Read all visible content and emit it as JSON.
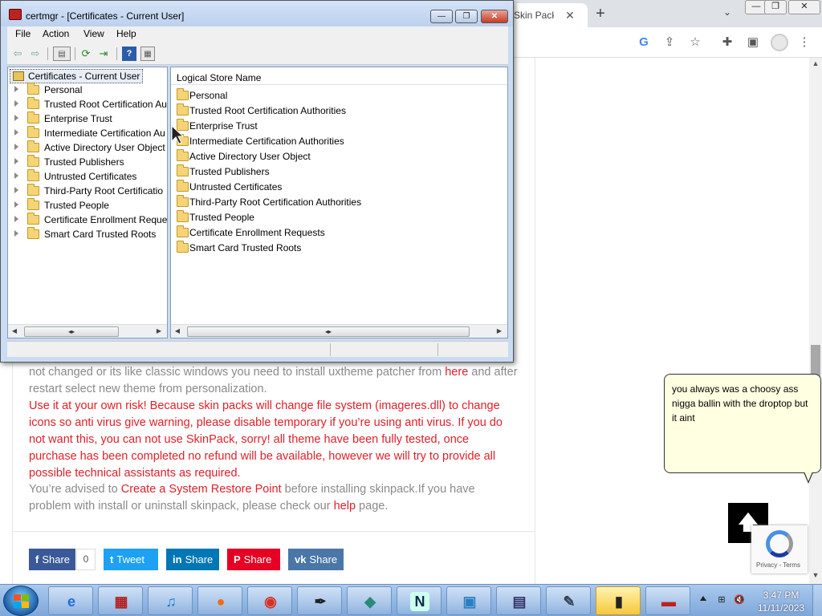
{
  "browser": {
    "tab_title": "Skin Pack f",
    "tab_close": "✕",
    "new_tab": "+",
    "tab_search": "⌄",
    "window_buttons": [
      "—",
      "❐",
      "✕"
    ],
    "toolbar_icons": [
      "G",
      "⇪",
      "☆",
      "✚",
      "▣",
      "⋮"
    ],
    "scroll_up": "▲",
    "scroll_down": "▼"
  },
  "article": {
    "line_intro_1": "not changed or its like classic windows you need to install uxtheme patcher from ",
    "line_intro_link": "here",
    "line_intro_2": " and after restart select new theme from personalization.",
    "warning": "Use it at your own risk! Because skin packs will change file system (imageres.dll) to change icons so anti virus give warning, please disable temporary if you’re using anti virus. If you do not want this, you can not use SkinPack, sorry! all theme have been fully tested, once purchase has been completed no refund will be available, however we will try to provide all possible technical assistants as required.",
    "advice_1": "You’re advised to ",
    "advice_link": "Create a System Restore Point",
    "advice_2": " before installing skinpack.If you have problem with install or uninstall skinpack, please check our ",
    "advice_help": "help",
    "advice_3": " page."
  },
  "share": {
    "facebook_icon": "f",
    "facebook": "Share",
    "facebook_count": "0",
    "twitter_icon": "t",
    "twitter": "Tweet",
    "linkedin_icon": "in",
    "linkedin": "Share",
    "pinterest_icon": "P",
    "pinterest": "Share",
    "vk_icon": "vk",
    "vk": "Share",
    "colors": {
      "facebook": "#3b5998",
      "twitter": "#1da1f2",
      "linkedin": "#0077b5",
      "pinterest": "#e60023",
      "vk": "#4a76a8"
    }
  },
  "back_to_top": "🡅",
  "recaptcha": {
    "links": "Privacy - Terms"
  },
  "balloon": {
    "text": "you always was a choosy ass nigga ballin with the droptop but it aint"
  },
  "certmgr": {
    "title": "certmgr - [Certificates - Current User]",
    "buttons": {
      "minimize": "—",
      "maximize": "❐",
      "close": "✕"
    },
    "menu": [
      "File",
      "Action",
      "View",
      "Help"
    ],
    "toolbar_icons": [
      "back-arrow",
      "forward-arrow",
      "console-tree",
      "refresh",
      "export-list",
      "help",
      "properties"
    ],
    "tree_root": "Certificates - Current User",
    "tree_items": [
      "Personal",
      "Trusted Root Certification Au",
      "Enterprise Trust",
      "Intermediate Certification Au",
      "Active Directory User Object",
      "Trusted Publishers",
      "Untrusted Certificates",
      "Third-Party Root Certificatio",
      "Trusted People",
      "Certificate Enrollment Reques",
      "Smart Card Trusted Roots"
    ],
    "list_header": "Logical Store Name",
    "list_items": [
      "Personal",
      "Trusted Root Certification Authorities",
      "Enterprise Trust",
      "Intermediate Certification Authorities",
      "Active Directory User Object",
      "Trusted Publishers",
      "Untrusted Certificates",
      "Third-Party Root Certification Authorities",
      "Trusted People",
      "Certificate Enrollment Requests",
      "Smart Card Trusted Roots"
    ],
    "scroll_left": "◀",
    "scroll_right": "▶",
    "scroll_grip": "◂▸"
  },
  "taskbar": {
    "apps": [
      {
        "name": "internet-explorer",
        "glyph": "e",
        "color": "#1e6fd9",
        "bg": "transparent"
      },
      {
        "name": "store",
        "glyph": "▦",
        "color": "#b32020",
        "bg": "transparent"
      },
      {
        "name": "itunes",
        "glyph": "♫",
        "color": "#1a7fd4",
        "bg": "transparent"
      },
      {
        "name": "firefox",
        "glyph": "●",
        "color": "#f56a10",
        "bg": "transparent"
      },
      {
        "name": "chrome",
        "glyph": "◉",
        "color": "#d93025",
        "bg": "transparent"
      },
      {
        "name": "paint-tool",
        "glyph": "✒",
        "color": "#222",
        "bg": "transparent"
      },
      {
        "name": "cubes",
        "glyph": "◆",
        "color": "#2a8a7a",
        "bg": "transparent"
      },
      {
        "name": "netscape",
        "glyph": "N",
        "color": "#0a2a4a",
        "bg": "#cfe"
      },
      {
        "name": "photo-viewer",
        "glyph": "▣",
        "color": "#2a7fc1",
        "bg": "transparent"
      },
      {
        "name": "system-tool",
        "glyph": "▤",
        "color": "#336",
        "bg": "transparent"
      },
      {
        "name": "notepad",
        "glyph": "✎",
        "color": "#345",
        "bg": "transparent"
      },
      {
        "name": "card-reader",
        "glyph": "▮",
        "color": "#222",
        "bg": "transparent"
      },
      {
        "name": "toolbox",
        "glyph": "▬",
        "color": "#c02020",
        "bg": "transparent"
      }
    ],
    "tray_icons": [
      "⊞",
      "🔇"
    ],
    "time": "3:47 PM",
    "date": "11/11/2023"
  }
}
